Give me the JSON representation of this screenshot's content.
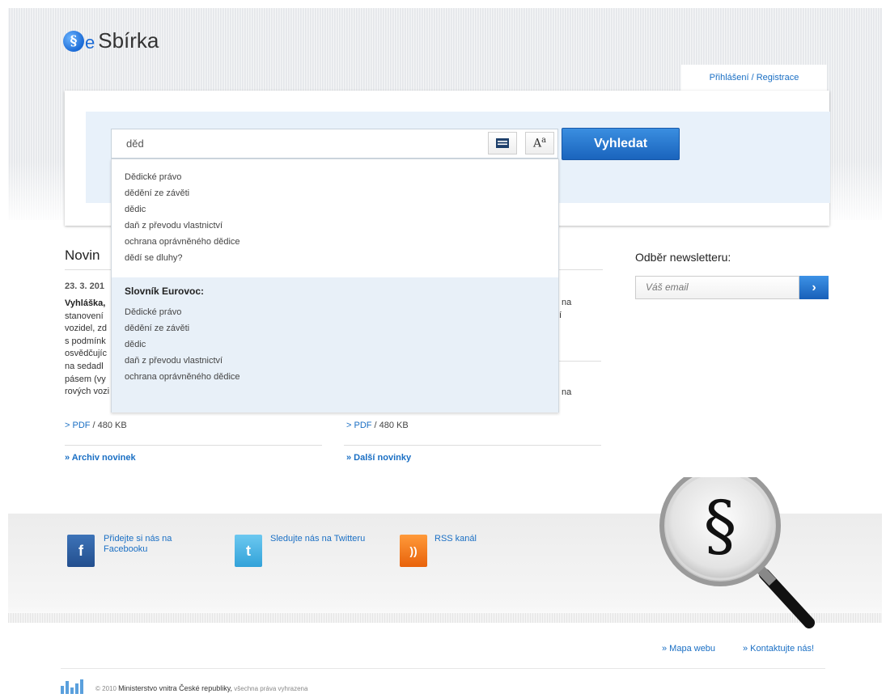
{
  "header": {
    "logo_e": "e",
    "logo_text": "Sbírka",
    "login_link": "Přihlášení / Registrace"
  },
  "search": {
    "value": "děd",
    "button_label": "Vyhledat",
    "font_btn_label": "A",
    "font_btn_sup": "a"
  },
  "dropdown": {
    "suggestions": [
      "Dědické právo",
      "dědění ze závěti",
      "dědic",
      "daň z převodu vlastnictví",
      "ochrana oprávněného dědice",
      "dědí se dluhy?"
    ],
    "eurovoc_title": "Slovník Eurovoc:",
    "eurovoc_items": [
      "Dědické právo",
      "dědění ze závěti",
      "dědic",
      "daň z převodu vlastnictví",
      "ochrana oprávněného dědice"
    ]
  },
  "news": {
    "title": "Novin",
    "date": "23. 3. 201",
    "text_lines": [
      "Vyhláška,",
      "stanovení",
      "vozidel, zd",
      "s podmínk",
      "osvědčujíc",
      "na sedadl",
      "pásem (vy",
      "rových vozi"
    ],
    "frag_1": "na",
    "frag_2": "í",
    "frag_3": "na",
    "pdf_label": "> PDF",
    "pdf_size": " / 480 KB",
    "archive_link": "» Archiv novinek",
    "more_link": "» Další novinky"
  },
  "newsletter": {
    "title": "Odběr newsletteru:",
    "placeholder": "Váš email",
    "button_label": "›"
  },
  "social": {
    "facebook": "Přidejte si nás na Facebooku",
    "twitter": "Sledujte nás na Twitteru",
    "rss": "RSS kanál",
    "fb_glyph": "f",
    "tw_glyph": "t",
    "rss_glyph": "))"
  },
  "footer": {
    "sitemap": "» Mapa webu",
    "contact": "» Kontaktujte nás!",
    "copy_prefix": "© 2010",
    "ministry": "Ministerstvo vnitra České republiky,",
    "rights": " všechna práva vyhrazena"
  },
  "magnifier_symbol": "§",
  "logo_symbol": "§"
}
